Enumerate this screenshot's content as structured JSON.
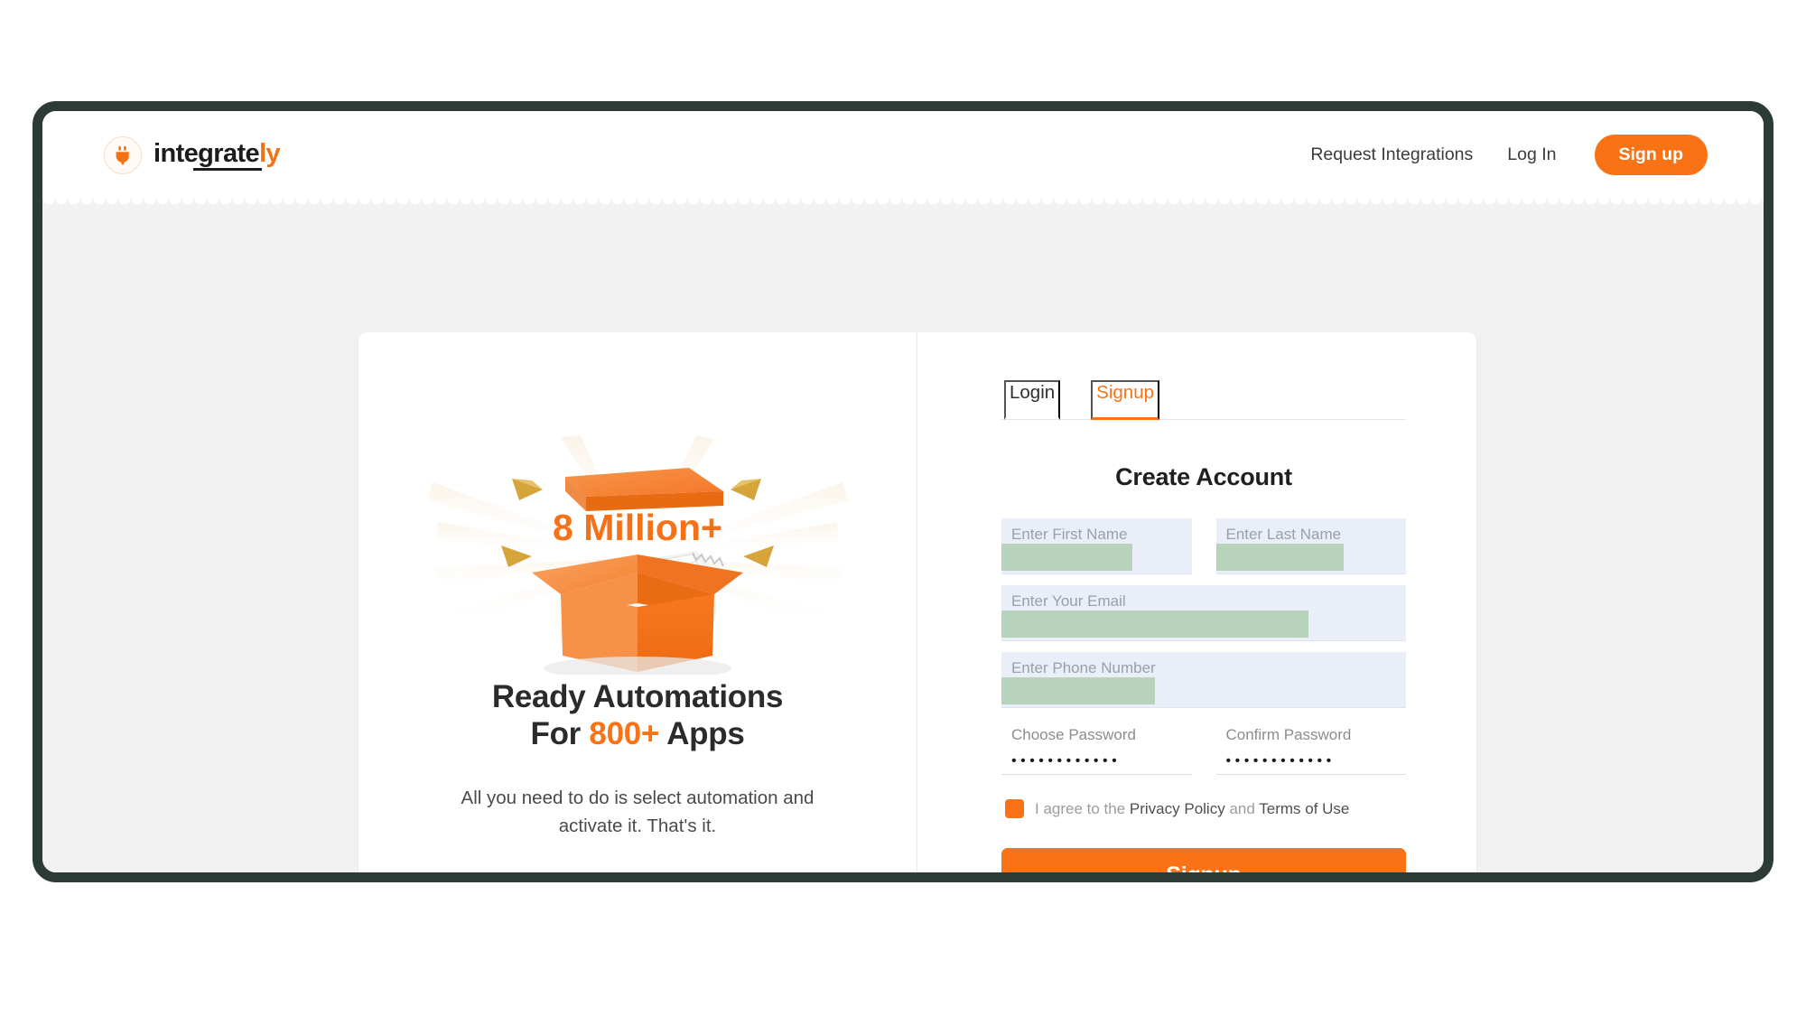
{
  "header": {
    "brand": {
      "icon": "plug-logo-icon",
      "name_part1": "integrate",
      "name_part2": "ly"
    },
    "nav": [
      {
        "label": "Request Integrations",
        "name": "request-integrations"
      },
      {
        "label": "Log In",
        "name": "log-in"
      }
    ],
    "cta_label": "Sign up"
  },
  "promo": {
    "badge_text": "8 Million+",
    "heading_line1": "Ready Automations",
    "heading_for": "For",
    "heading_highlight": "800+",
    "heading_apps": "Apps",
    "subtitle": "All you need to do is select automation and activate it. That's it."
  },
  "auth": {
    "tabs": [
      {
        "label": "Login",
        "active": false
      },
      {
        "label": "Signup",
        "active": true
      }
    ],
    "title": "Create Account",
    "fields": {
      "first_name": {
        "label": "Enter First Name",
        "value": ""
      },
      "last_name": {
        "label": "Enter Last Name",
        "value": ""
      },
      "email": {
        "label": "Enter Your Email",
        "value": ""
      },
      "phone": {
        "label": "Enter Phone Number",
        "value": ""
      },
      "password": {
        "label": "Choose Password",
        "value": "••••••••••••"
      },
      "confirm_password": {
        "label": "Confirm Password",
        "value": "••••••••••••"
      }
    },
    "terms": {
      "prefix": "I agree to the ",
      "privacy_link": "Privacy Policy",
      "conjunction": " and ",
      "terms_link": "Terms of Use",
      "checked": true
    },
    "submit_label": "Signup"
  },
  "colors": {
    "accent": "#f97316",
    "frame": "#2c3b35",
    "field_bg": "#e9eef9",
    "redaction": "#b8d3bb",
    "page_bg": "#f1f1f1"
  }
}
